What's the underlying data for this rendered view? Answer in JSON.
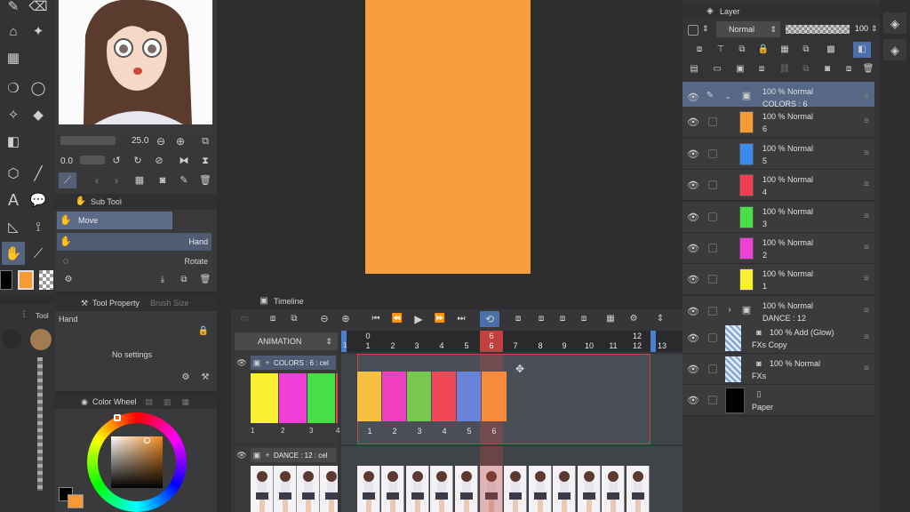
{
  "tools": {
    "size_value": "25.0",
    "opacity_value": "0.0"
  },
  "subtool": {
    "title": "Sub Tool",
    "group": "Move",
    "items": [
      "Hand",
      "Rotate"
    ]
  },
  "tool_property": {
    "tab_active": "Tool Property",
    "tab_inactive": "Brush Size",
    "tool_name": "Hand",
    "empty_text": "No settings"
  },
  "tool_tab": "Tool",
  "color_wheel": {
    "title": "Color Wheel",
    "main_color": "#3a3a3c",
    "sub_color": "#f79a35"
  },
  "timeline": {
    "title": "Timeline",
    "animation_label": "ANIMATION",
    "frame_numbers": [
      "1",
      "2",
      "3",
      "4",
      "5",
      "6",
      "7",
      "8",
      "9",
      "10",
      "11",
      "12",
      "13"
    ],
    "top_markers": [
      "0",
      "6",
      "12"
    ],
    "current_frame": "6",
    "ruler_left_mark": "1",
    "colors_track": {
      "label": "COLORS : 6 : cel",
      "cels": [
        "1",
        "2",
        "3",
        "4",
        "5",
        "6"
      ],
      "left_numbers": [
        "1",
        "2",
        "3",
        "4"
      ]
    },
    "dance_track": {
      "label": "DANCE : 12 : cel"
    }
  },
  "layer_panel": {
    "title": "Layer",
    "blend_mode": "Normal",
    "opacity": "100",
    "layers": [
      {
        "l1": "100 % Normal",
        "l2": "COLORS : 6",
        "type": "folder",
        "color": ""
      },
      {
        "l1": "100 % Normal",
        "l2": "6",
        "type": "cel",
        "color": "#f79a35"
      },
      {
        "l1": "100 % Normal",
        "l2": "5",
        "type": "cel",
        "color": "#3b8cf0"
      },
      {
        "l1": "100 % Normal",
        "l2": "4",
        "type": "cel",
        "color": "#f04050"
      },
      {
        "l1": "100 % Normal",
        "l2": "3",
        "type": "cel",
        "color": "#46e046"
      },
      {
        "l1": "100 % Normal",
        "l2": "2",
        "type": "cel",
        "color": "#f040d8"
      },
      {
        "l1": "100 % Normal",
        "l2": "1",
        "type": "cel",
        "color": "#f8f030"
      },
      {
        "l1": "100 % Normal",
        "l2": "DANCE : 12",
        "type": "folder",
        "color": ""
      },
      {
        "l1": "100 % Add (Glow)",
        "l2": "FXs Copy",
        "type": "fx",
        "color": ""
      },
      {
        "l1": "100 % Normal",
        "l2": "FXs",
        "type": "fx",
        "color": ""
      },
      {
        "l1": "",
        "l2": "Paper",
        "type": "paper",
        "color": "#000000"
      }
    ]
  },
  "canvas": {
    "fill_color": "#f79f3c"
  }
}
